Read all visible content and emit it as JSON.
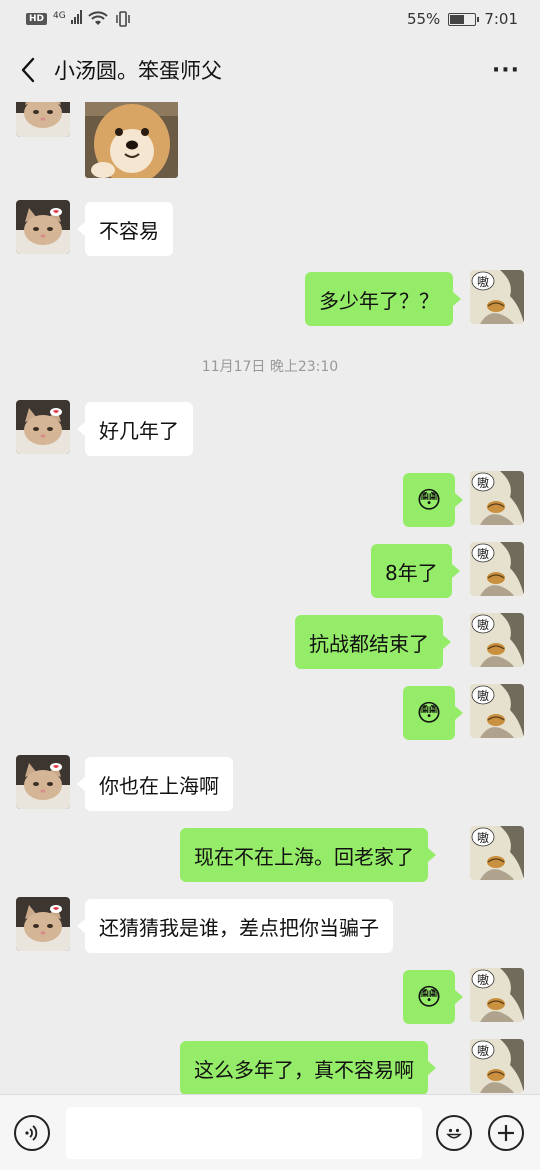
{
  "status_bar": {
    "hd": "HD",
    "network": "4G",
    "battery": "55%",
    "battery_level": 0.55,
    "time": "7:01"
  },
  "header": {
    "title": "小汤圆。笨蛋师父",
    "more": "···"
  },
  "messages": [
    {
      "side": "left",
      "type": "image",
      "desc": "dog-sticker"
    },
    {
      "side": "left",
      "type": "text",
      "text": "不容易"
    },
    {
      "side": "right",
      "type": "text",
      "text": "多少年了？？"
    },
    {
      "type": "time",
      "text": "11月17日 晚上23:10"
    },
    {
      "side": "left",
      "type": "text",
      "text": "好几年了"
    },
    {
      "side": "right",
      "type": "emoji",
      "emoji": "😳"
    },
    {
      "side": "right",
      "type": "text",
      "text": "8年了"
    },
    {
      "side": "right",
      "type": "text",
      "text": "抗战都结束了"
    },
    {
      "side": "right",
      "type": "emoji",
      "emoji": "😳"
    },
    {
      "side": "left",
      "type": "text",
      "text": "你也在上海啊"
    },
    {
      "side": "right",
      "type": "text",
      "text": "现在不在上海。回老家了"
    },
    {
      "side": "left",
      "type": "text",
      "text": "还猜猜我是谁，差点把你当骗子"
    },
    {
      "side": "right",
      "type": "emoji",
      "emoji": "😳"
    },
    {
      "side": "right",
      "type": "text",
      "text": "这么多年了，真不容易啊"
    }
  ],
  "avatar_text": "嗷",
  "colors": {
    "background": "#ededed",
    "bubble_self": "#95ec69",
    "bubble_other": "#ffffff",
    "input_bar": "#f6f6f6"
  },
  "input": {
    "value": "",
    "placeholder": ""
  }
}
